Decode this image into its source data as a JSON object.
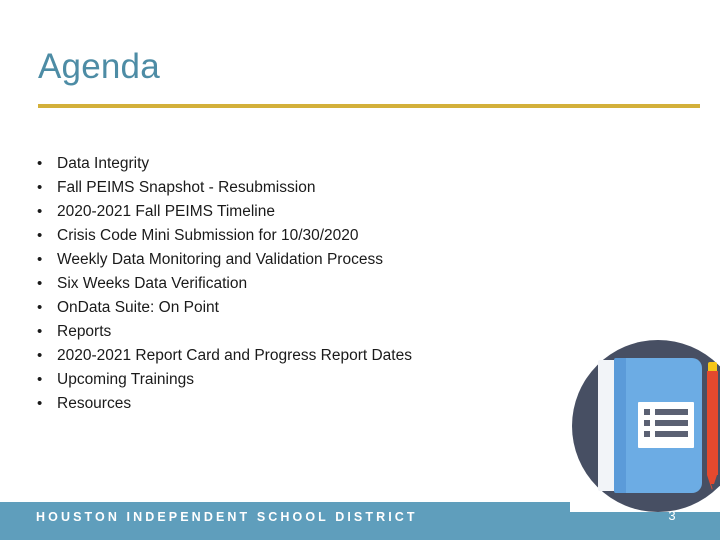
{
  "slide": {
    "title": "Agenda",
    "page_number": "3",
    "colors": {
      "title": "#4d8ca5",
      "rule": "#d3b03a",
      "footer_band": "#5f9ebc",
      "illustration_circle": "#474f63",
      "book_cover": "#6cace4",
      "book_spine": "#5b9bd9",
      "pencil_body": "#e4492e",
      "pencil_eraser": "#f5c518",
      "body_text": "#1a1a1a"
    }
  },
  "agenda": {
    "bullet_glyph": "•",
    "items": [
      "Data Integrity",
      "Fall PEIMS Snapshot - Resubmission",
      "2020-2021 Fall PEIMS Timeline",
      "Crisis Code Mini Submission for 10/30/2020",
      "Weekly Data Monitoring and Validation Process",
      "Six Weeks Data Verification",
      "OnData Suite: On Point",
      "Reports",
      "2020-2021 Report Card and Progress Report Dates",
      "Upcoming Trainings",
      "Resources"
    ]
  },
  "footer": {
    "organization": "HOUSTON INDEPENDENT SCHOOL DISTRICT"
  },
  "illustration": {
    "name": "notebook-and-pencil-illustration",
    "label_rows": 3
  }
}
